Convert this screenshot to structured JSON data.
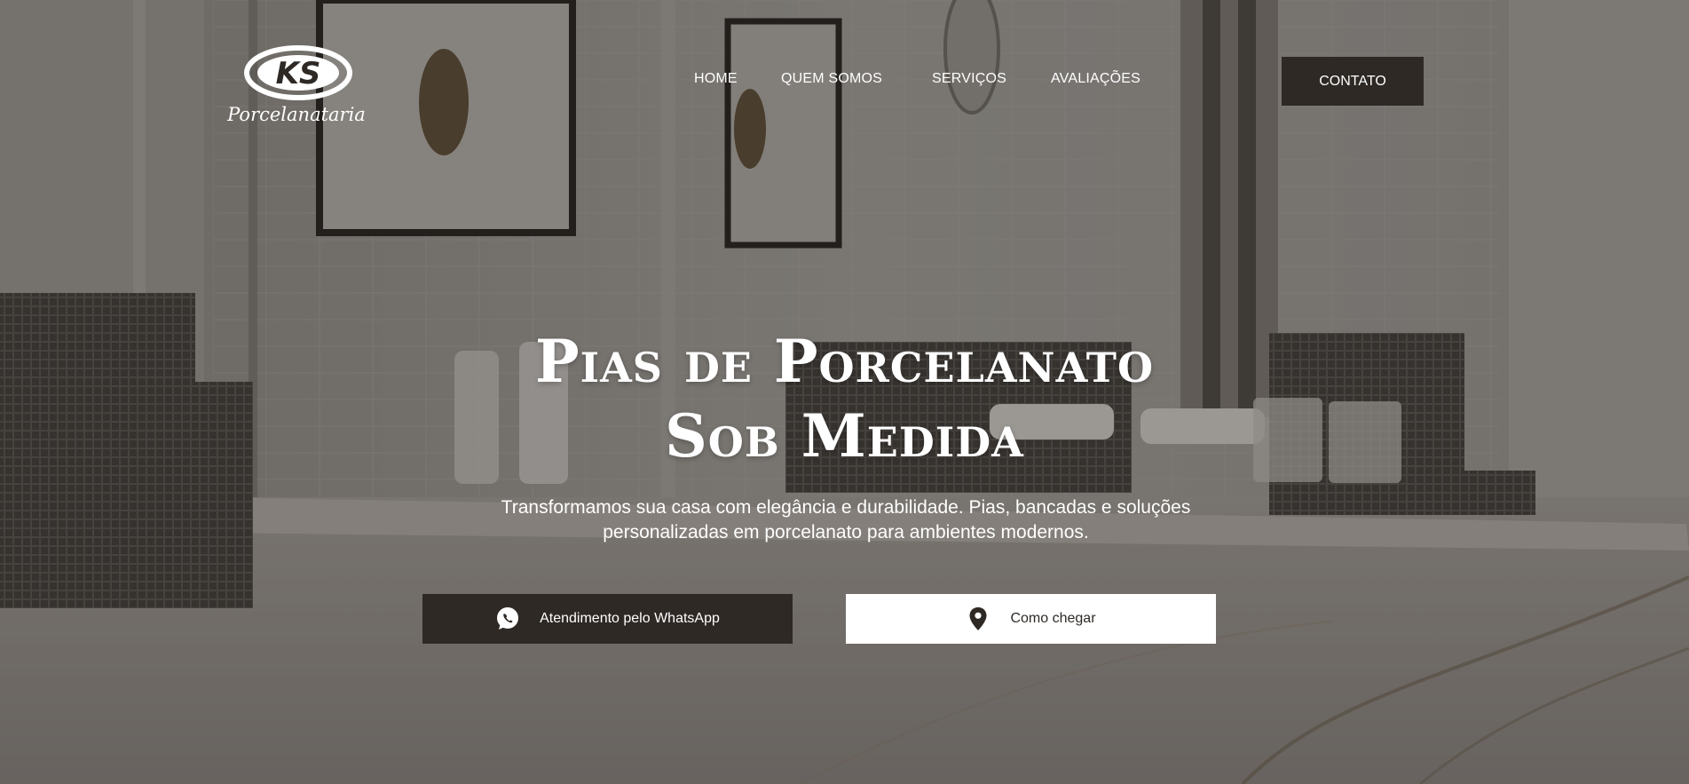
{
  "brand": {
    "logo_initials": "KS",
    "logo_wordmark": "Porcelanataria"
  },
  "nav": {
    "items": [
      {
        "label": "HOME"
      },
      {
        "label": "QUEM SOMOS"
      },
      {
        "label": "SERVIÇOS"
      },
      {
        "label": "AVALIAÇÕES"
      }
    ],
    "contact_label": "CONTATO"
  },
  "hero": {
    "title_line1": "Pias de Porcelanato",
    "title_line2": "Sob Medida",
    "subtitle": "Transformamos sua casa com elegância e durabilidade. Pias, bancadas e soluções personalizadas em porcelanato para ambientes modernos.",
    "whatsapp_label": "Atendimento pelo WhatsApp",
    "whatsapp_icon": "whatsapp-icon",
    "map_label": "Como chegar",
    "map_icon": "map-pin-icon"
  },
  "colors": {
    "dark_button": "#2e2925",
    "text_light": "#ffffff"
  }
}
